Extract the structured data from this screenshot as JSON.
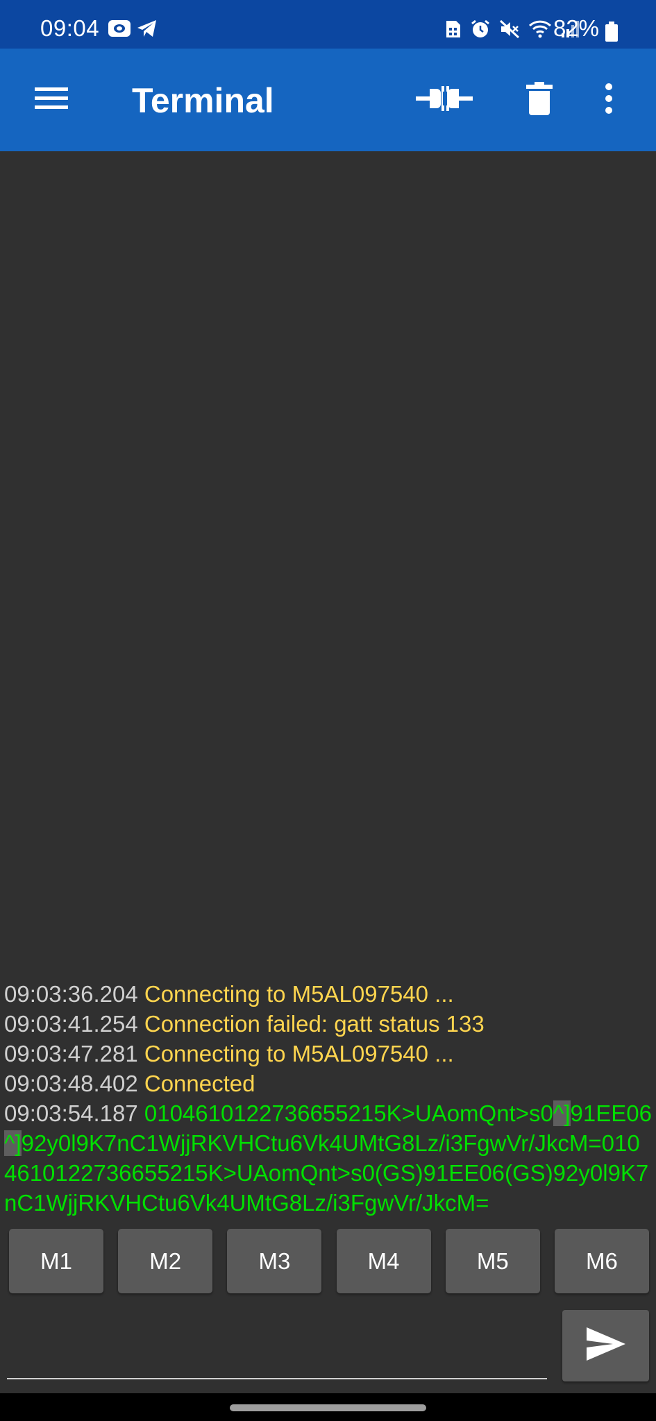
{
  "status_bar": {
    "time": "09:04",
    "battery": "82%",
    "icons": [
      "outlook-icon",
      "telegram-icon",
      "sim-icon",
      "alarm-icon",
      "mute-icon",
      "wifi-icon",
      "signal-icon",
      "battery-icon"
    ]
  },
  "app_bar": {
    "title": "Terminal",
    "menu_icon": "hamburger-menu-icon",
    "connect_icon": "plug-connect-icon",
    "delete_icon": "trash-icon",
    "more_icon": "more-vert-icon"
  },
  "log": [
    {
      "time": "09:03:36.204",
      "message": "Connecting to M5AL097540 ..."
    },
    {
      "time": "09:03:41.254",
      "message": "Connection failed: gatt status 133"
    },
    {
      "time": "09:03:47.281",
      "message": "Connecting to M5AL097540 ..."
    },
    {
      "time": "09:03:48.402",
      "message": "Connected"
    },
    {
      "time": "09:03:54.187",
      "data_parts": [
        "0104610122736655215K>UAomQnt>s0",
        "^]",
        "91EE06",
        "^]",
        "92y0l9K7nC1WjjRKVHCtu6Vk4UMtG8Lz/i3FgwVr/JkcM=0104610122736655215K>UAomQnt>s0(GS)91EE06(GS)92y0l9K7nC1WjjRKVHCtu6Vk4UMtG8Lz/i3FgwVr/JkcM="
      ]
    }
  ],
  "macros": [
    "M1",
    "M2",
    "M3",
    "M4",
    "M5",
    "M6"
  ],
  "input": {
    "value": "",
    "placeholder": ""
  },
  "colors": {
    "status_bar": "#0c47a1",
    "app_bar": "#1565c0",
    "terminal_bg": "#303030",
    "timestamp": "#d0d0d0",
    "status_message": "#ffd54f",
    "received_data": "#00e000"
  }
}
